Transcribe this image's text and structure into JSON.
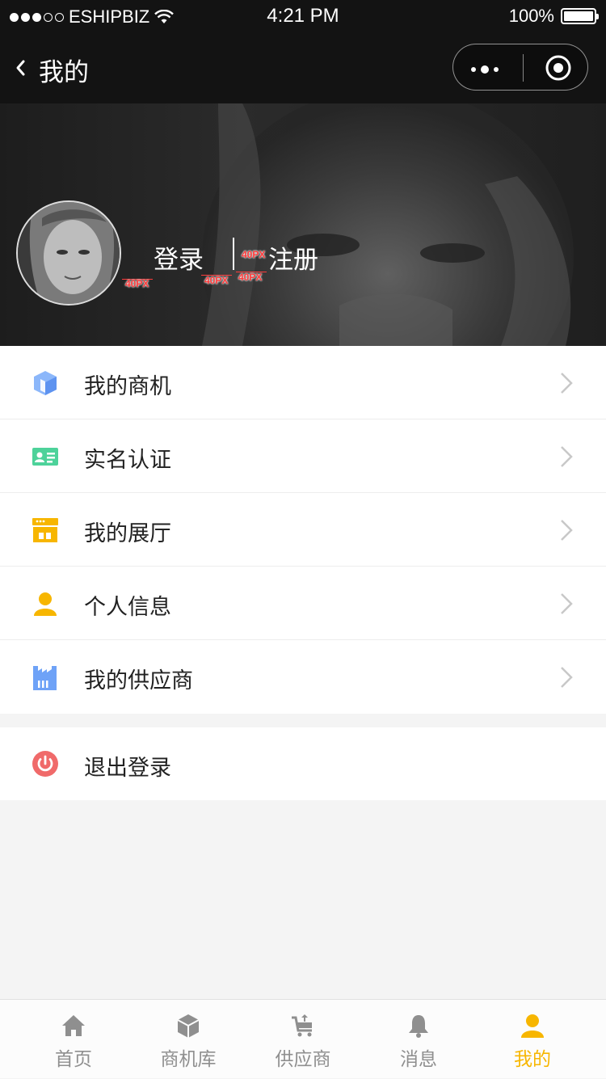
{
  "status_bar": {
    "carrier": "ESHIPBIZ",
    "time": "4:21 PM",
    "battery": "100%"
  },
  "nav": {
    "title": "我的"
  },
  "profile": {
    "login_label": "登录",
    "register_label": "注册",
    "annotations": [
      "40PX",
      "40PX",
      "40PX",
      "40PX"
    ]
  },
  "menu": [
    {
      "label": "我的商机",
      "icon": "business-opportunity-icon",
      "color": "#6ea2f7"
    },
    {
      "label": "实名认证",
      "icon": "id-card-icon",
      "color": "#4dd29a"
    },
    {
      "label": "我的展厅",
      "icon": "showroom-icon",
      "color": "#f7b600"
    },
    {
      "label": "个人信息",
      "icon": "person-icon",
      "color": "#f7b600"
    },
    {
      "label": "我的供应商",
      "icon": "factory-icon",
      "color": "#6ea2f7"
    }
  ],
  "logout": {
    "label": "退出登录",
    "color": "#f06a6a"
  },
  "tabs": [
    {
      "label": "首页",
      "icon": "home-icon",
      "active": false
    },
    {
      "label": "商机库",
      "icon": "box-icon",
      "active": false
    },
    {
      "label": "供应商",
      "icon": "cart-icon",
      "active": false
    },
    {
      "label": "消息",
      "icon": "bell-icon",
      "active": false
    },
    {
      "label": "我的",
      "icon": "user-icon",
      "active": true
    }
  ],
  "colors": {
    "accent": "#f7b600",
    "tab_inactive": "#8f8f8f"
  }
}
